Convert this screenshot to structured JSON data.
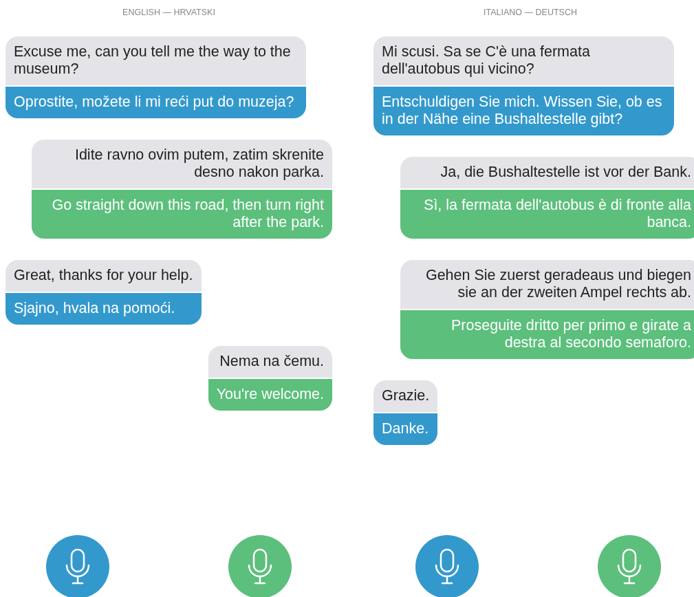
{
  "panels": [
    {
      "header": "ENGLISH — HRVATSKI",
      "messages": [
        {
          "kind": "left",
          "original": "Excuse me, can you tell me the way to the museum?",
          "translation": "Oprostite, možete li mi reći put do muzeja?"
        },
        {
          "kind": "right",
          "original": "Idite ravno ovim putem, zatim skrenite desno nakon parka.",
          "translation": "Go straight down this road, then turn right after the park."
        },
        {
          "kind": "left",
          "original": "Great, thanks for your help.",
          "translation": "Sjajno, hvala na pomoći."
        },
        {
          "kind": "right",
          "original": "Nema na čemu.",
          "translation": "You're welcome."
        }
      ],
      "mics": [
        {
          "color": "#3399cc"
        },
        {
          "color": "#5cbf7c"
        }
      ]
    },
    {
      "header": "ITALIANO — DEUTSCH",
      "messages": [
        {
          "kind": "left",
          "original": "Mi scusi. Sa se C'è una fermata dell'autobus qui vicino?",
          "translation": "Entschuldigen Sie mich. Wissen Sie, ob es in der Nähe eine Bushaltestelle gibt?"
        },
        {
          "kind": "right",
          "original": "Ja, die Bushaltestelle ist vor der Bank.",
          "translation": "Sì, la fermata dell'autobus è di fronte alla banca."
        },
        {
          "kind": "right",
          "original": "Gehen Sie zuerst geradeaus und biegen sie an der zweiten Ampel rechts ab.",
          "translation": "Proseguite dritto per primo e girate a destra al secondo semaforo."
        },
        {
          "kind": "left",
          "original": "Grazie.",
          "translation": "Danke."
        }
      ],
      "mics": [
        {
          "color": "#3399cc"
        },
        {
          "color": "#5cbf7c"
        }
      ]
    }
  ]
}
